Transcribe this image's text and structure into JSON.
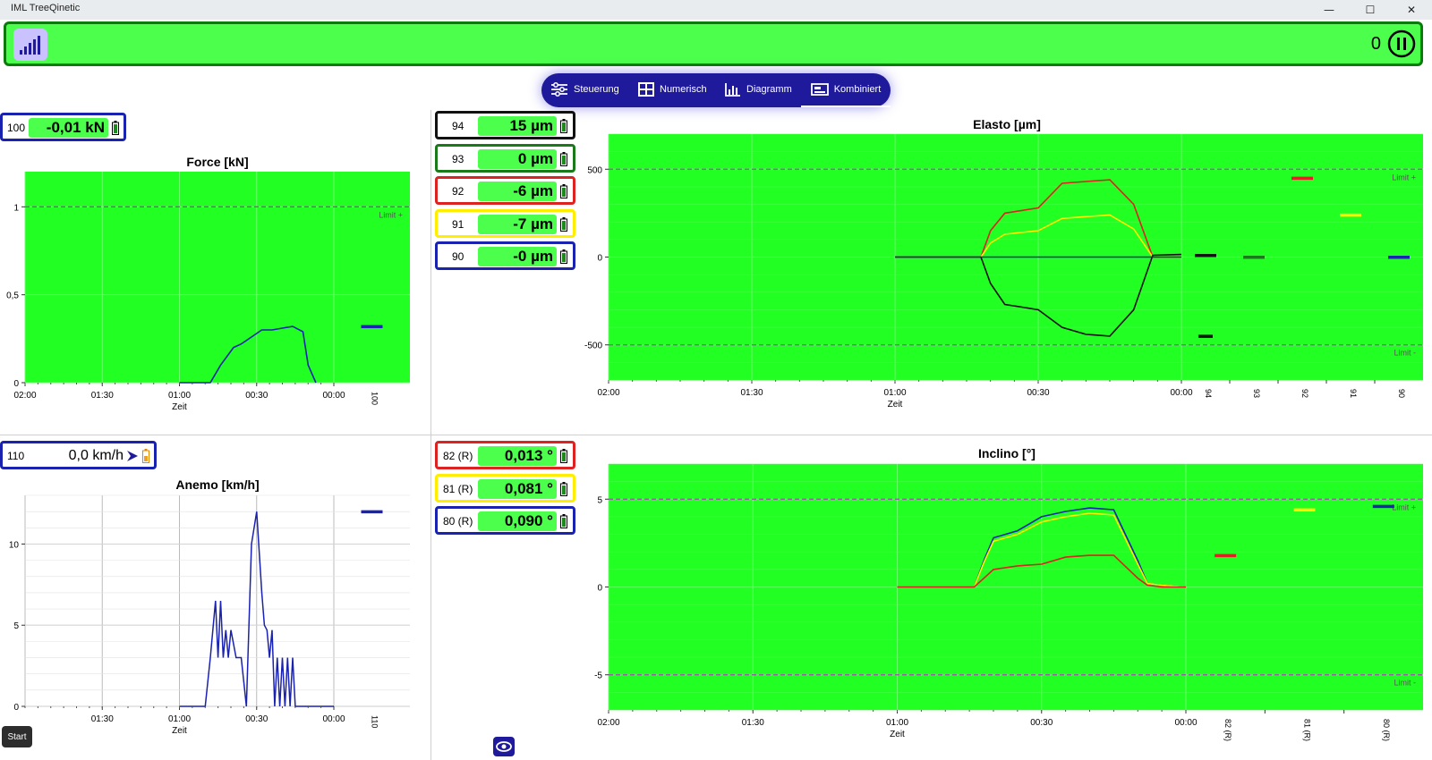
{
  "window": {
    "title": "IML TreeQinetic",
    "minimize": "—",
    "maximize": "☐",
    "close": "✕"
  },
  "topbar": {
    "counter": "0"
  },
  "nav": {
    "tabs": [
      "Steuerung",
      "Numerisch",
      "Diagramm",
      "Kombiniert"
    ],
    "active": "Kombiniert"
  },
  "colors": {
    "green": "#4cff4c",
    "plot": "#22ff22",
    "navy": "#1f1a9c",
    "black": "#111111",
    "red": "#dd2222",
    "yellow": "#ffee00",
    "blue": "#1a22b0",
    "limit": "#9b4fa8"
  },
  "force": {
    "sensor": {
      "id": "100",
      "value": "-0,01 kN"
    },
    "title": "Force [kN]",
    "y_ticks": [
      "0",
      "0,5",
      "1"
    ],
    "x_ticks": [
      "02:00",
      "01:30",
      "01:00",
      "00:30",
      "00:00"
    ],
    "x_label": "Zeit",
    "channel_label": "100",
    "limit_label": "Limit +"
  },
  "elasto": {
    "sensors": [
      {
        "id": "94",
        "value": "15 µm"
      },
      {
        "id": "93",
        "value": "0 µm"
      },
      {
        "id": "92",
        "value": "-6 µm"
      },
      {
        "id": "91",
        "value": "-7 µm"
      },
      {
        "id": "90",
        "value": "-0 µm"
      }
    ],
    "title": "Elasto [µm]",
    "y_ticks": [
      "500",
      "0",
      "-500"
    ],
    "x_ticks": [
      "02:00",
      "01:30",
      "01:00",
      "00:30",
      "00:00"
    ],
    "x_label": "Zeit",
    "channel_labels": [
      "94",
      "93",
      "92",
      "91",
      "90"
    ],
    "limit_plus": "Limit +",
    "limit_minus": "Limit -"
  },
  "anemo": {
    "sensor": {
      "id": "110",
      "value": "0,0 km/h"
    },
    "title": "Anemo [km/h]",
    "y_ticks": [
      "0",
      "5",
      "10"
    ],
    "x_ticks": [
      "01:30",
      "01:00",
      "00:30",
      "00:00"
    ],
    "x_label": "Zeit",
    "channel_label": "110"
  },
  "inclino": {
    "sensors": [
      {
        "id": "82 (R)",
        "value": "0,013 °"
      },
      {
        "id": "81 (R)",
        "value": "0,081 °"
      },
      {
        "id": "80 (R)",
        "value": "0,090 °"
      }
    ],
    "title": "Inclino [°]",
    "y_ticks": [
      "5",
      "0",
      "-5"
    ],
    "x_ticks": [
      "02:00",
      "01:30",
      "01:00",
      "00:30",
      "00:00"
    ],
    "x_label": "Zeit",
    "channel_labels": [
      "82 (R)",
      "81 (R)",
      "80 (R)"
    ],
    "limit_plus": "Limit +",
    "limit_minus": "Limit -"
  },
  "start_button": "Start",
  "chart_data": [
    {
      "type": "line",
      "title": "Force [kN]",
      "xlabel": "Zeit",
      "ylim": [
        0,
        1.2
      ],
      "limits": {
        "plus": 1
      },
      "series": [
        {
          "name": "100",
          "x": [
            -60,
            -48,
            -44,
            -39,
            -36,
            -32,
            -28,
            -24,
            -20,
            -16,
            -12,
            -10,
            -7
          ],
          "values": [
            0,
            0,
            0.1,
            0.2,
            0.22,
            0.26,
            0.3,
            0.3,
            0.31,
            0.32,
            0.29,
            0.1,
            0
          ]
        }
      ],
      "current": {
        "100": 0.32
      }
    },
    {
      "type": "line",
      "title": "Elasto [µm]",
      "xlabel": "Zeit",
      "ylim": [
        -700,
        700
      ],
      "limits": {
        "plus": 500,
        "minus": -500
      },
      "series": [
        {
          "name": "92",
          "x": [
            -60,
            -42,
            -40,
            -37,
            -30,
            -25,
            -20,
            -15,
            -10,
            -6,
            0
          ],
          "values": [
            0,
            0,
            150,
            250,
            280,
            420,
            430,
            440,
            300,
            0,
            0
          ]
        },
        {
          "name": "91",
          "x": [
            -60,
            -42,
            -40,
            -37,
            -30,
            -25,
            -20,
            -15,
            -10,
            -6,
            0
          ],
          "values": [
            0,
            0,
            80,
            130,
            150,
            220,
            230,
            240,
            160,
            0,
            0
          ]
        },
        {
          "name": "94",
          "x": [
            -60,
            -42,
            -40,
            -37,
            -30,
            -25,
            -20,
            -15,
            -10,
            -6,
            0
          ],
          "values": [
            0,
            0,
            -150,
            -270,
            -300,
            -400,
            -440,
            -450,
            -300,
            10,
            15
          ]
        },
        {
          "name": "90",
          "x": [
            -60,
            0
          ],
          "values": [
            0,
            0
          ]
        }
      ],
      "current": {
        "94": 10,
        "93": 0,
        "92": 450,
        "91": 240,
        "90": 0
      },
      "current_extra": {
        "94": -450
      }
    },
    {
      "type": "line",
      "title": "Anemo [km/h]",
      "xlabel": "Zeit",
      "ylim": [
        0,
        13
      ],
      "series": [
        {
          "name": "110",
          "x": [
            -60,
            -50,
            -48,
            -46,
            -45,
            -44,
            -43,
            -42,
            -41,
            -40,
            -38,
            -36,
            -34,
            -32,
            -30,
            -28,
            -27,
            -26,
            -25,
            -24,
            -23,
            -22,
            -21,
            -20,
            -19,
            -18,
            -17,
            -16,
            -15,
            -14,
            0
          ],
          "values": [
            0,
            0,
            3,
            6.5,
            3,
            6.5,
            3,
            4.7,
            3,
            4.7,
            3,
            3,
            0,
            10,
            12,
            7,
            5,
            4.7,
            3,
            4.7,
            0,
            3,
            0,
            3,
            0,
            3,
            0,
            3,
            0,
            0,
            0
          ]
        }
      ],
      "current": {
        "110": 12
      }
    },
    {
      "type": "line",
      "title": "Inclino [°]",
      "xlabel": "Zeit",
      "ylim": [
        -7,
        7
      ],
      "limits": {
        "plus": 5,
        "minus": -5
      },
      "series": [
        {
          "name": "80 (R)",
          "x": [
            -60,
            -44,
            -42,
            -40,
            -35,
            -30,
            -25,
            -20,
            -15,
            -10,
            -8,
            -5,
            0
          ],
          "values": [
            0,
            0,
            1.5,
            2.8,
            3.2,
            4,
            4.3,
            4.5,
            4.4,
            1.5,
            0.2,
            0.1,
            0
          ]
        },
        {
          "name": "81 (R)",
          "x": [
            -60,
            -44,
            -42,
            -40,
            -35,
            -30,
            -25,
            -20,
            -15,
            -10,
            -8,
            -5,
            0
          ],
          "values": [
            0,
            0,
            1.4,
            2.6,
            3,
            3.7,
            4,
            4.2,
            4.1,
            1.3,
            0.2,
            0.1,
            0
          ]
        },
        {
          "name": "82 (R)",
          "x": [
            -60,
            -44,
            -42,
            -40,
            -35,
            -30,
            -25,
            -20,
            -15,
            -10,
            -8,
            -5,
            0
          ],
          "values": [
            0,
            0,
            0.5,
            1,
            1.2,
            1.3,
            1.7,
            1.8,
            1.8,
            0.5,
            0.1,
            0,
            0
          ]
        }
      ],
      "current": {
        "82 (R)": 1.8,
        "81 (R)": 4.4,
        "80 (R)": 4.6
      }
    }
  ]
}
